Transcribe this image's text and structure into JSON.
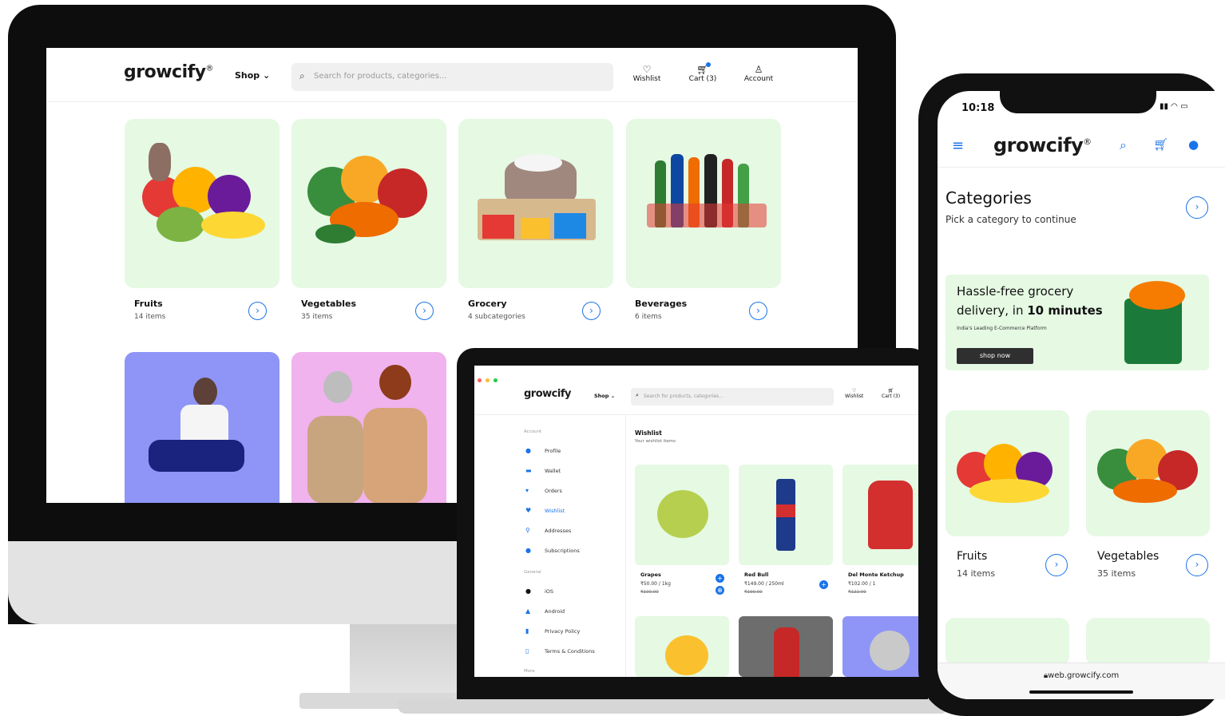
{
  "desktop": {
    "brand": "growcify",
    "brand_mark": "®",
    "shop_label": "Shop",
    "search_placeholder": "Search for products, categories...",
    "nav": {
      "wishlist": "Wishlist",
      "cart": "Cart (3)",
      "account": "Account"
    },
    "categories": [
      {
        "name": "Fruits",
        "count": "14 items"
      },
      {
        "name": "Vegetables",
        "count": "35 items"
      },
      {
        "name": "Grocery",
        "count": "4 subcategories"
      },
      {
        "name": "Beverages",
        "count": "6 items"
      }
    ]
  },
  "laptop": {
    "brand": "growcify",
    "shop_label": "Shop",
    "search_placeholder": "Search for products, categories...",
    "nav": {
      "wishlist": "Wishlist",
      "cart": "Cart (3)"
    },
    "sidebar": {
      "account_heading": "Account",
      "account_items": [
        "Profile",
        "Wallet",
        "Orders",
        "Wishlist",
        "Addresses",
        "Subscriptions"
      ],
      "general_heading": "General",
      "general_items": [
        "iOS",
        "Android",
        "Privacy Policy",
        "Terms & Conditions"
      ],
      "more_heading": "More"
    },
    "page_title": "Wishlist",
    "page_subtitle": "Your wishlist items",
    "items": [
      {
        "name": "Grapes",
        "price": "₹50.00 / 1kg",
        "mrp": "₹100.00"
      },
      {
        "name": "Red Bull",
        "price": "₹149.00 / 250ml",
        "mrp": "₹199.00"
      },
      {
        "name": "Del Monte Ketchup",
        "price": "₹102.00 / 1",
        "mrp": "₹122.00"
      }
    ]
  },
  "phone": {
    "time": "10:18",
    "brand": "growcify",
    "title": "Categories",
    "subtitle": "Pick a category to continue",
    "banner": {
      "line1": "Hassle-free grocery",
      "line2_prefix": "delivery, in ",
      "line2_bold": "10 minutes",
      "tagline": "India's Leading E-Commerce Platform",
      "button": "shop now"
    },
    "categories": [
      {
        "name": "Fruits",
        "count": "14 items"
      },
      {
        "name": "Vegetables",
        "count": "35 items"
      }
    ],
    "url": "web.growcify.com"
  },
  "colors": {
    "accent": "#1a73e8",
    "card_green": "#e5f9e3",
    "banner_button": "#2f2f2f"
  }
}
